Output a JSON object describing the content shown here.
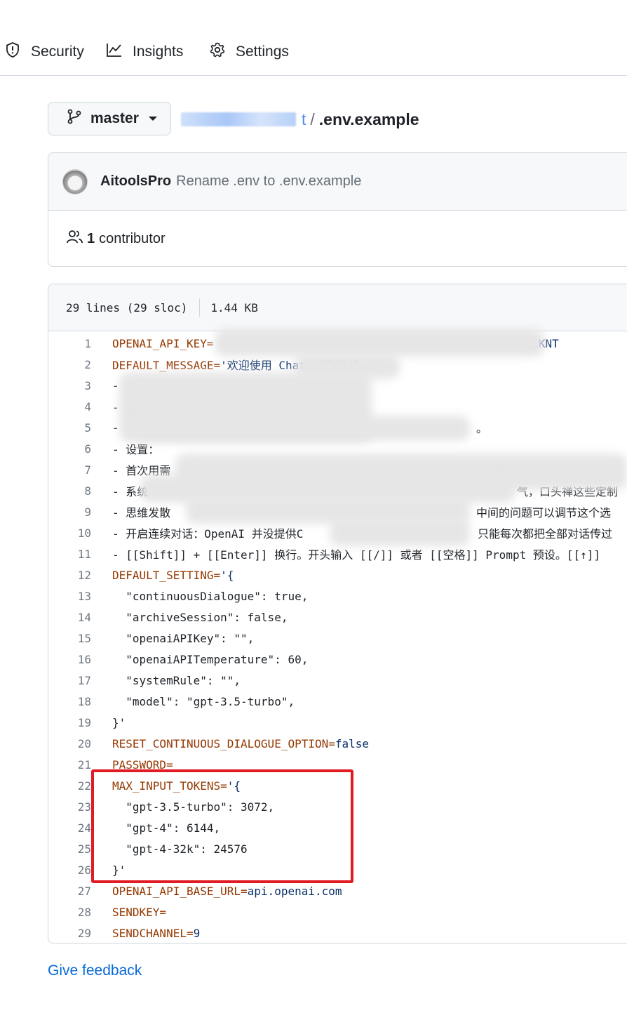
{
  "nav": {
    "items": [
      {
        "label": "Security",
        "icon": "shield-icon"
      },
      {
        "label": "Insights",
        "icon": "graph-icon"
      },
      {
        "label": "Settings",
        "icon": "gear-icon"
      }
    ]
  },
  "breadcrumb": {
    "branch": "master",
    "repo_suffix": "t",
    "separator": "/",
    "file": ".env.example"
  },
  "commit": {
    "author": "AitoolsPro",
    "message": "Rename .env to .env.example",
    "contributors": "1",
    "contributors_label": "contributor"
  },
  "file": {
    "lines_info": "29 lines (29 sloc)",
    "size": "1.44 KB"
  },
  "code_lines": [
    {
      "n": "1",
      "k": "OPENAI_API_KEY=",
      "v": "",
      "tail": "25LKNT"
    },
    {
      "n": "2",
      "k": "DEFAULT_MESSAGE=",
      "v": "'欢迎使用 ChatGPT聊天机",
      "tail": ""
    },
    {
      "n": "3",
      "k": "",
      "v": "-",
      "tail": ""
    },
    {
      "n": "4",
      "k": "",
      "v": "- 抨",
      "tail": ""
    },
    {
      "n": "5",
      "k": "",
      "v": "-  [",
      "tail": "。"
    },
    {
      "n": "6",
      "k": "",
      "v": "- 设置：",
      "tail": ""
    },
    {
      "n": "7",
      "k": "",
      "v": "- 首次用需",
      "tail": ""
    },
    {
      "n": "8",
      "k": "",
      "v": "- 系统",
      "tail": "气，口头禅这些定制"
    },
    {
      "n": "9",
      "k": "",
      "v": "- 思维发散",
      "tail": "中间的问题可以调节这个选"
    },
    {
      "n": "10",
      "k": "",
      "v": "- 开启连续对话：OpenAI 并没提供C",
      "tail": "只能每次都把全部对话传过"
    },
    {
      "n": "11",
      "k": "",
      "v": "- [[Shift]] + [[Enter]] 换行。开头输入 [[/]] 或者 [[空格]] Prompt 预设。[[↑]]",
      "tail": ""
    },
    {
      "n": "12",
      "k": "DEFAULT_SETTING=",
      "v": "'{",
      "tail": ""
    },
    {
      "n": "13",
      "k": "",
      "v": "  \"continuousDialogue\": true,",
      "tail": ""
    },
    {
      "n": "14",
      "k": "",
      "v": "  \"archiveSession\": false,",
      "tail": ""
    },
    {
      "n": "15",
      "k": "",
      "v": "  \"openaiAPIKey\": \"\",",
      "tail": ""
    },
    {
      "n": "16",
      "k": "",
      "v": "  \"openaiAPITemperature\": 60,",
      "tail": ""
    },
    {
      "n": "17",
      "k": "",
      "v": "  \"systemRule\": \"\",",
      "tail": ""
    },
    {
      "n": "18",
      "k": "",
      "v": "  \"model\": \"gpt-3.5-turbo\",",
      "tail": ""
    },
    {
      "n": "19",
      "k": "",
      "v": "}'",
      "tail": ""
    },
    {
      "n": "20",
      "k": "RESET_CONTINUOUS_DIALOGUE_OPTION=",
      "v": "false",
      "tail": ""
    },
    {
      "n": "21",
      "k": "PASSWORD=",
      "v": "",
      "tail": ""
    },
    {
      "n": "22",
      "k": "MAX_INPUT_TOKENS=",
      "v": "'{",
      "tail": ""
    },
    {
      "n": "23",
      "k": "",
      "v": "  \"gpt-3.5-turbo\": 3072,",
      "tail": ""
    },
    {
      "n": "24",
      "k": "",
      "v": "  \"gpt-4\": 6144,",
      "tail": ""
    },
    {
      "n": "25",
      "k": "",
      "v": "  \"gpt-4-32k\": 24576",
      "tail": ""
    },
    {
      "n": "26",
      "k": "",
      "v": "}'",
      "tail": ""
    },
    {
      "n": "27",
      "k": "OPENAI_API_BASE_URL=",
      "v": "api.openai.com",
      "tail": ""
    },
    {
      "n": "28",
      "k": "SENDKEY=",
      "v": "",
      "tail": ""
    },
    {
      "n": "29",
      "k": "SENDCHANNEL=",
      "v": "9",
      "tail": ""
    }
  ],
  "footer": {
    "feedback": "Give feedback"
  },
  "colors": {
    "link": "#0969da",
    "key": "#953800",
    "highlight": "#e01b24"
  }
}
